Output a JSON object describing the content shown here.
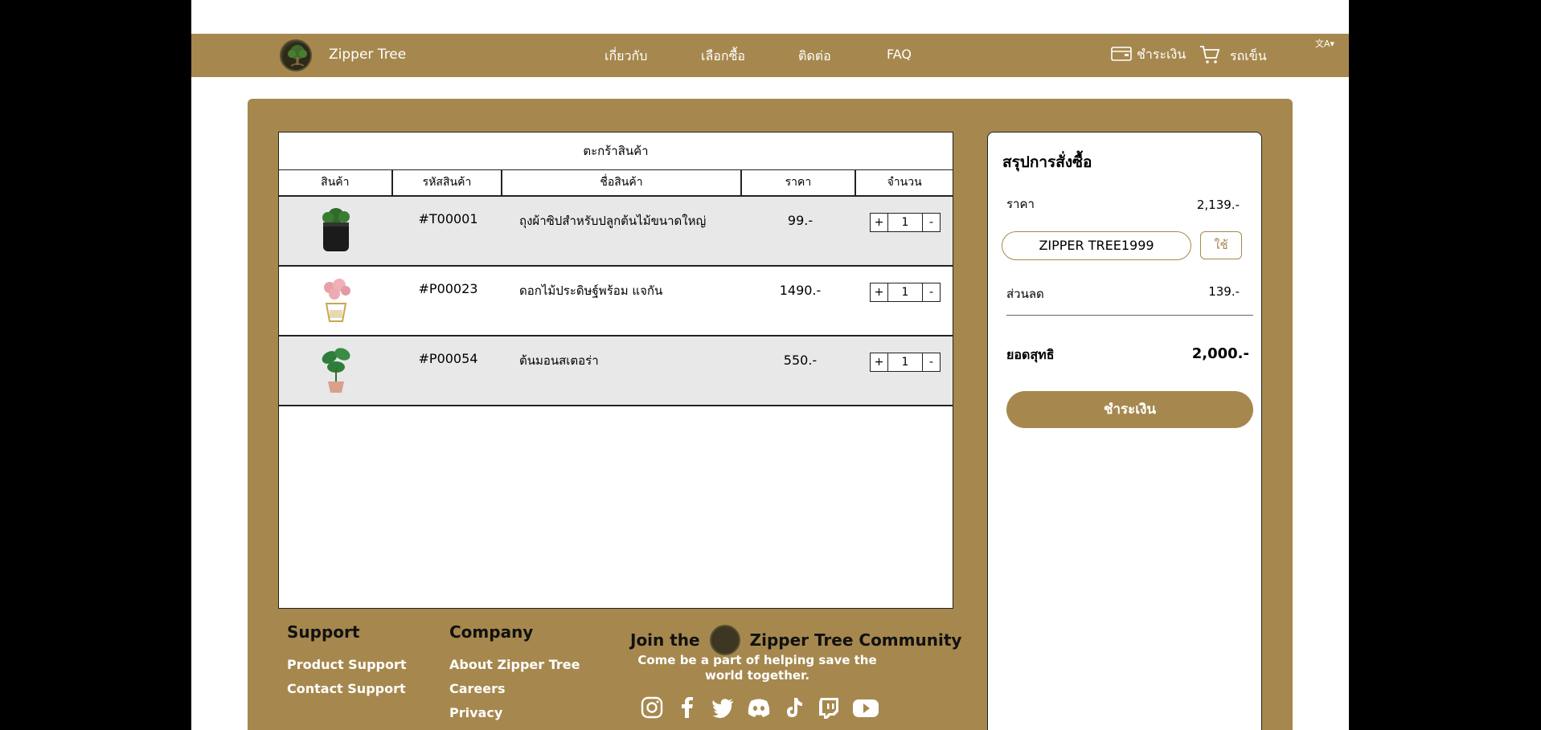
{
  "nav": {
    "brand": "Zipper Tree",
    "links": [
      "เกี่ยวกับ",
      "เลือกซื้อ",
      "ติดต่อ",
      "FAQ"
    ],
    "checkout": "ชำระเงิน",
    "cart": "รถเข็น",
    "lang": "文A▾"
  },
  "cart": {
    "title": "ตะกร้าสินค้า",
    "headers": [
      "สินค้า",
      "รหัสสินค้า",
      "ชื่อสินค้า",
      "ราคา",
      "จำนวน"
    ],
    "items": [
      {
        "code": "#T00001",
        "name": "ถุงผ้าซิปสำหรับปลูกต้นไม้ขนาดใหญ่",
        "price": "99.-",
        "qty": "1"
      },
      {
        "code": "#P00023",
        "name": "ดอกไม้ประดิษฐ์พร้อม แจกัน",
        "price": "1490.-",
        "qty": "1"
      },
      {
        "code": "#P00054",
        "name": "ต้นมอนสเตอร่า",
        "price": "550.-",
        "qty": "1"
      }
    ],
    "plus": "+",
    "minus": "-"
  },
  "summary": {
    "title": "สรุปการสั่งซื้อ",
    "price_label": "ราคา",
    "price_value": "2,139.-",
    "coupon": "ZIPPER TREE1999",
    "apply": "ใช้",
    "discount_label": "ส่วนลด",
    "discount_value": "139.-",
    "total_label": "ยอดสุทธิ",
    "total_value": "2,000.-",
    "pay": "ชำระเงิน"
  },
  "footer": {
    "support_title": "Support",
    "support_links": [
      "Product Support",
      "Contact Support"
    ],
    "company_title": "Company",
    "company_links": [
      "About Zipper Tree",
      "Careers",
      "Privacy"
    ],
    "join_prefix": "Join the",
    "join_suffix": "Zipper Tree Community",
    "tagline": "Come be a part of helping save the world together.",
    "socials": [
      "instagram-icon",
      "facebook-icon",
      "twitter-icon",
      "discord-icon",
      "tiktok-icon",
      "twitch-icon",
      "youtube-icon"
    ]
  },
  "colors": {
    "brand": "#a6884e"
  }
}
